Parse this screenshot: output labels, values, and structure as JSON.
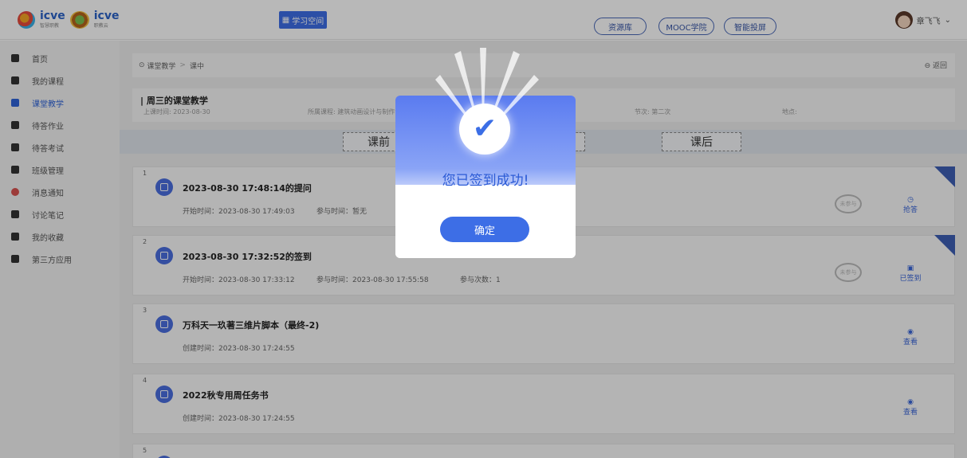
{
  "header": {
    "logo_text": "icve",
    "logo_sub": "智慧职教",
    "logo2_text": "icve",
    "logo2_sub": "职教云",
    "study_space": "学习空间",
    "nav": [
      "资源库",
      "MOOC学院",
      "智能投屏"
    ],
    "user_name": "章飞飞"
  },
  "sidebar": {
    "items": [
      {
        "label": "首页",
        "active": false
      },
      {
        "label": "我的课程",
        "active": false
      },
      {
        "label": "课堂教学",
        "active": true
      },
      {
        "label": "待答作业",
        "active": false
      },
      {
        "label": "待答考试",
        "active": false
      },
      {
        "label": "班级管理",
        "active": false
      },
      {
        "label": "消息通知",
        "active": false
      },
      {
        "label": "讨论笔记",
        "active": false
      },
      {
        "label": "我的收藏",
        "active": false
      },
      {
        "label": "第三方应用",
        "active": false
      }
    ]
  },
  "breadcrumb": {
    "root": "课堂教学",
    "sep": ">",
    "current": "课中",
    "back": "返回"
  },
  "lesson": {
    "title": "周三的课堂教学",
    "date": "上课时间: 2023-08-30",
    "course": "所属课程: 建筑动画设计与制作专业",
    "section": "节次: 第二次",
    "location": "地点:"
  },
  "phases": {
    "before": "课前",
    "after": "课后"
  },
  "cards": [
    {
      "num": "1",
      "title": "2023-08-30 17:48:14的提问",
      "meta1": "开始时间：2023-08-30 17:49:03",
      "meta2": "参与时间：暂无",
      "meta3": "",
      "stamp": "未参与",
      "action": "抢答",
      "corner": true
    },
    {
      "num": "2",
      "title": "2023-08-30 17:32:52的签到",
      "meta1": "开始时间：2023-08-30 17:33:12",
      "meta2": "参与时间：2023-08-30 17:55:58",
      "meta3": "参与次数：1",
      "stamp": "未参与",
      "action": "已签到",
      "corner": true
    },
    {
      "num": "3",
      "title": "万科天一玖著三维片脚本（最终-2)",
      "meta1": "创建时间：2023-08-30 17:24:55",
      "meta2": "",
      "meta3": "",
      "stamp": "",
      "action": "查看",
      "corner": false
    },
    {
      "num": "4",
      "title": "2022秋专用周任务书",
      "meta1": "创建时间：2023-08-30 17:24:55",
      "meta2": "",
      "meta3": "",
      "stamp": "",
      "action": "查看",
      "corner": false
    },
    {
      "num": "5",
      "title": "",
      "meta1": "",
      "meta2": "",
      "meta3": "",
      "stamp": "",
      "action": "",
      "corner": false
    }
  ],
  "modal": {
    "message": "您已签到成功!",
    "confirm": "确定"
  },
  "colors": {
    "accent": "#3d6ee6",
    "sidebar_bg": "#f3f3f3"
  }
}
